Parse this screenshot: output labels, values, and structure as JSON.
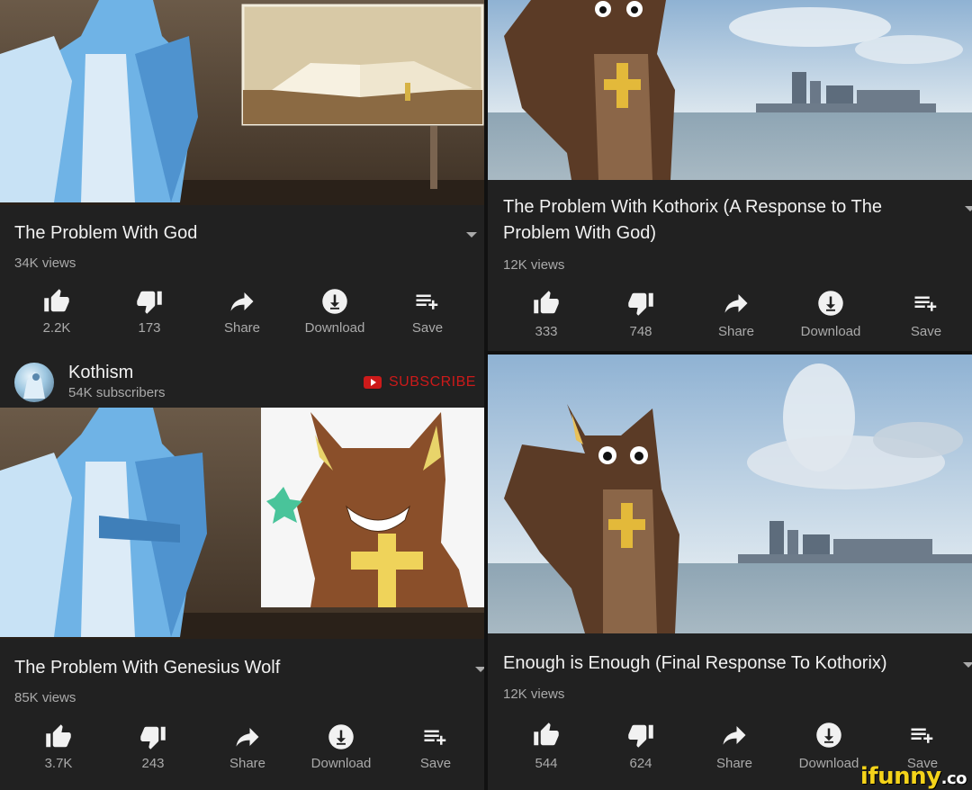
{
  "panels": [
    {
      "title_lines": [
        "The Problem With God"
      ],
      "views": "34K views",
      "likes": "2.2K",
      "dislikes": "173"
    },
    {
      "title_lines": [
        "The Problem With Kothorix (A Response to The",
        "Problem With God)"
      ],
      "views": "12K views",
      "likes": "333",
      "dislikes": "748"
    },
    {
      "title_lines": [
        "The Problem With Genesius Wolf"
      ],
      "views": "85K views",
      "likes": "3.7K",
      "dislikes": "243"
    },
    {
      "title_lines": [
        "Enough is Enough (Final Response To Kothorix)"
      ],
      "views": "12K views",
      "likes": "544",
      "dislikes": "624"
    }
  ],
  "actions": {
    "share_label": "Share",
    "download_label": "Download",
    "save_label": "Save"
  },
  "channel": {
    "name": "Kothism",
    "subscribers": "54K subscribers",
    "subscribe_label": "SUBSCRIBE"
  },
  "watermark": {
    "text": "ifunny",
    "suffix": ".co"
  },
  "icons": {
    "like": "thumb-up-icon",
    "dislike": "thumb-down-icon",
    "share": "share-arrow-icon",
    "download": "download-circle-icon",
    "save": "playlist-add-icon"
  },
  "colors": {
    "background": "#212121",
    "text_primary": "#f1f1f1",
    "text_secondary": "#aaaaaa",
    "subscribe_red": "#cc1a1a",
    "watermark_yellow": "#f4d31a"
  }
}
